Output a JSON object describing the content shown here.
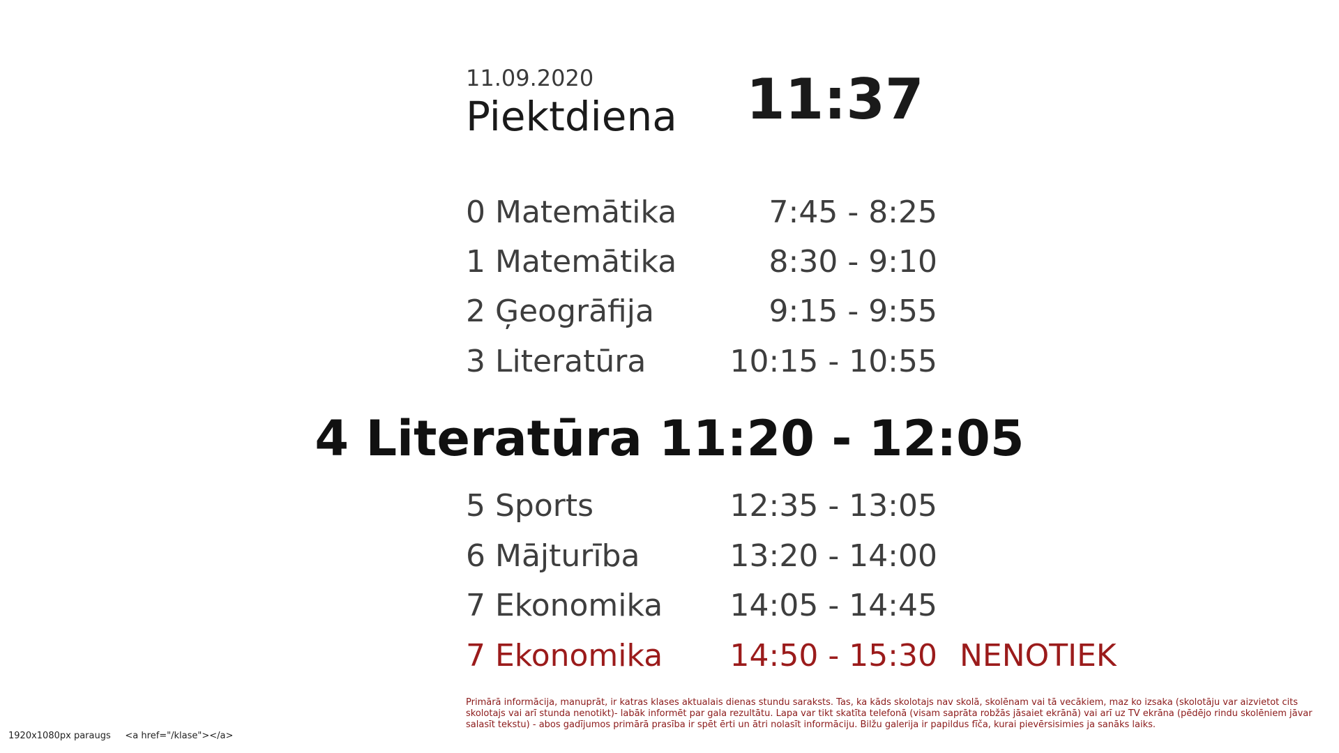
{
  "header": {
    "date": "11.09.2020",
    "weekday": "Piektdiena",
    "clock": "11:37"
  },
  "lessons_before": [
    {
      "subject": "0 Matemātika",
      "time": "7:45 - 8:25"
    },
    {
      "subject": "1 Matemātika",
      "time": "8:30 - 9:10"
    },
    {
      "subject": "2 Ģeogrāfija",
      "time": "9:15 - 9:55"
    },
    {
      "subject": "3 Literatūra",
      "time": "10:15 - 10:55"
    }
  ],
  "current_lesson": "4 Literatūra 11:20 - 12:05",
  "lessons_after": [
    {
      "subject": "5 Sports",
      "time": "12:35 - 13:05"
    },
    {
      "subject": "6 Mājturība",
      "time": "13:20 - 14:00"
    },
    {
      "subject": "7 Ekonomika",
      "time": "14:05 - 14:45"
    },
    {
      "subject": "7 Ekonomika",
      "time": "14:50 - 15:30",
      "status": "NENOTIEK"
    }
  ],
  "note": "Primārā informācija, manuprāt, ir katras klases aktualais dienas stundu saraksts. Tas, ka kāds skolotajs nav skolā, skolēnam vai tā vecākiem, maz ko izsaka (skolotāju var aizvietot cits skolotajs vai arī stunda nenotikt)- labāk informēt par gala rezultātu. Lapa var tikt skatīta telefonā (visam saprāta robžās jāsaiet ekrānā) vai arī uz TV ekrāna (pēdējo rindu skolēniem jāvar salasīt tekstu) - abos gadījumos primārā prasība ir spēt ērti un ātri nolasīt informāciju. Bilžu galerija ir papildus fīča, kurai pievērsisimies ja sanāks laiks.",
  "footer": {
    "size_label": "1920x1080px paraugs",
    "code_label": "<a href=\"/klase\"></a>"
  },
  "colors": {
    "cancelled": "#9b1b1b",
    "text": "#3e3e3e"
  }
}
